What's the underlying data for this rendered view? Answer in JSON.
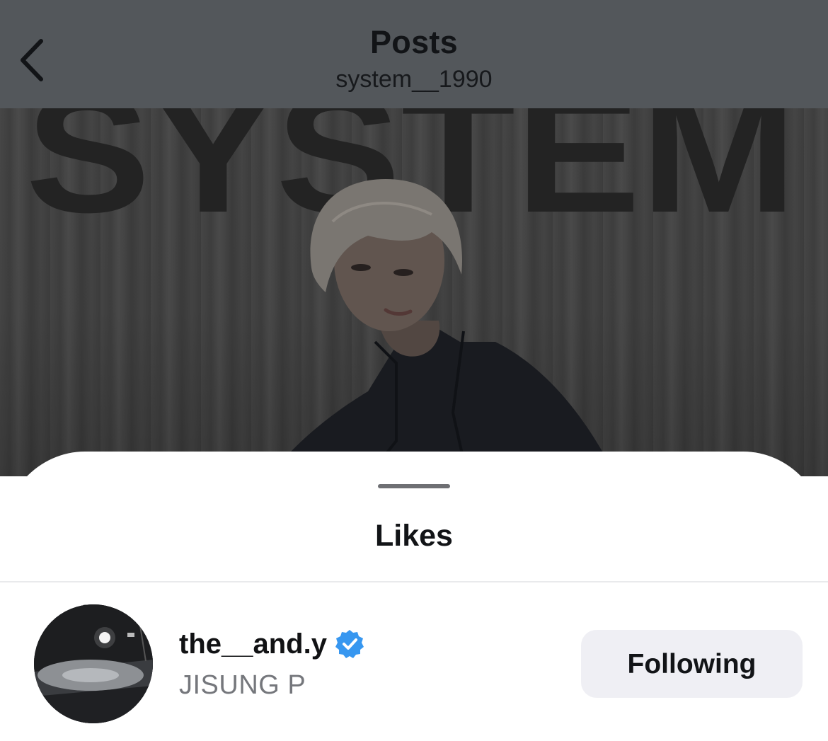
{
  "header": {
    "title": "Posts",
    "subtitle": "system__1990",
    "back_icon": "chevron-left-icon"
  },
  "post": {
    "image_text": "SYSTEM"
  },
  "likes_sheet": {
    "title": "Likes",
    "users": [
      {
        "username": "the__and.y",
        "verified": true,
        "verified_icon": "verified-badge-icon",
        "full_name": "JISUNG P",
        "button_label": "Following"
      }
    ]
  },
  "colors": {
    "header_bg_dimmed": "#53575b",
    "verified_blue": "#3797f0",
    "button_bg": "#efeff4",
    "secondary_text": "#75777c"
  }
}
